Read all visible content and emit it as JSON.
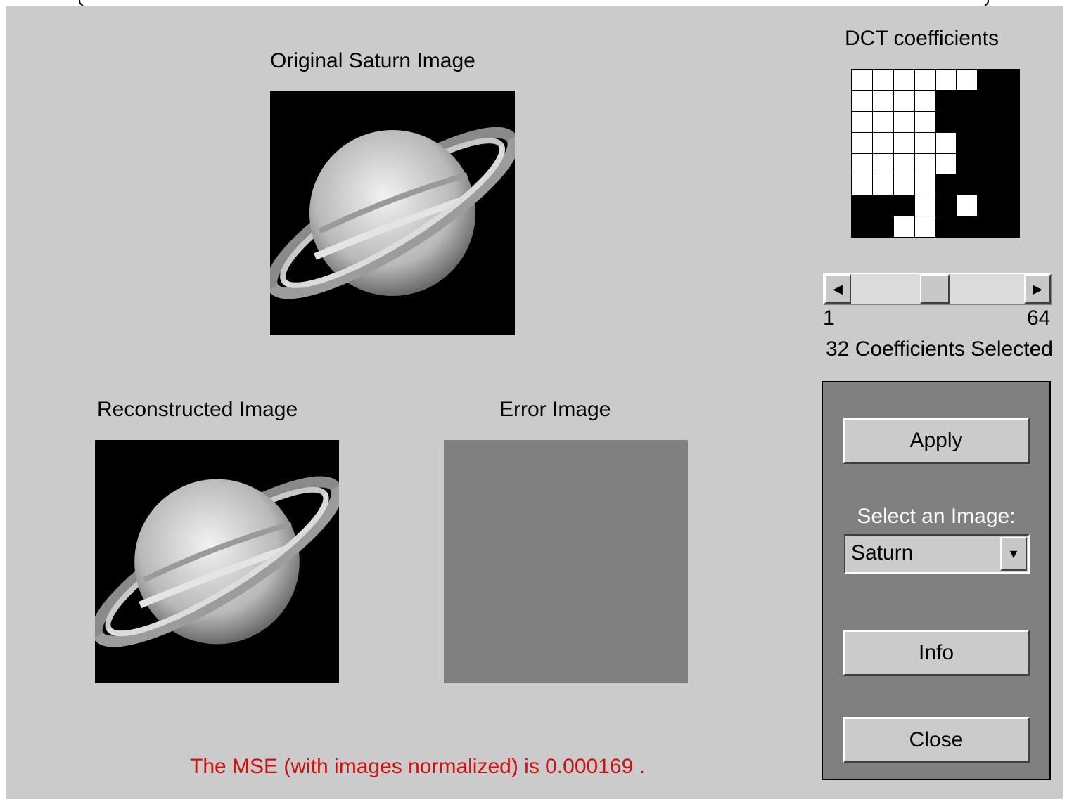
{
  "window": {
    "original_title": "Original Saturn Image",
    "reconstructed_title": "Reconstructed Image",
    "error_title": "Error Image",
    "dct_title": "DCT coefficients",
    "mse_text": "The MSE (with images normalized) is 0.000169 ."
  },
  "dct_mask": [
    [
      1,
      1,
      1,
      1,
      1,
      1,
      0,
      0
    ],
    [
      1,
      1,
      1,
      1,
      0,
      0,
      0,
      0
    ],
    [
      1,
      1,
      1,
      1,
      0,
      0,
      0,
      0
    ],
    [
      1,
      1,
      1,
      1,
      1,
      0,
      0,
      0
    ],
    [
      1,
      1,
      1,
      1,
      1,
      0,
      0,
      0
    ],
    [
      1,
      1,
      1,
      1,
      0,
      0,
      0,
      0
    ],
    [
      0,
      0,
      0,
      1,
      0,
      1,
      0,
      0
    ],
    [
      0,
      0,
      1,
      1,
      0,
      0,
      0,
      0
    ]
  ],
  "slider": {
    "min_label": "1",
    "max_label": "64",
    "value": 32,
    "min": 1,
    "max": 64,
    "status_text": "32 Coefficients Selected",
    "left_arrow_icon": "arrow-left-icon",
    "right_arrow_icon": "arrow-right-icon"
  },
  "panel": {
    "apply_label": "Apply",
    "select_label": "Select an Image:",
    "selected_image": "Saturn",
    "dropdown_icon": "chevron-down-icon",
    "info_label": "Info",
    "close_label": "Close"
  },
  "colors": {
    "background": "#cbcbcb",
    "panel": "#808080",
    "mse_text": "#d01010",
    "error_image": "#808080"
  }
}
